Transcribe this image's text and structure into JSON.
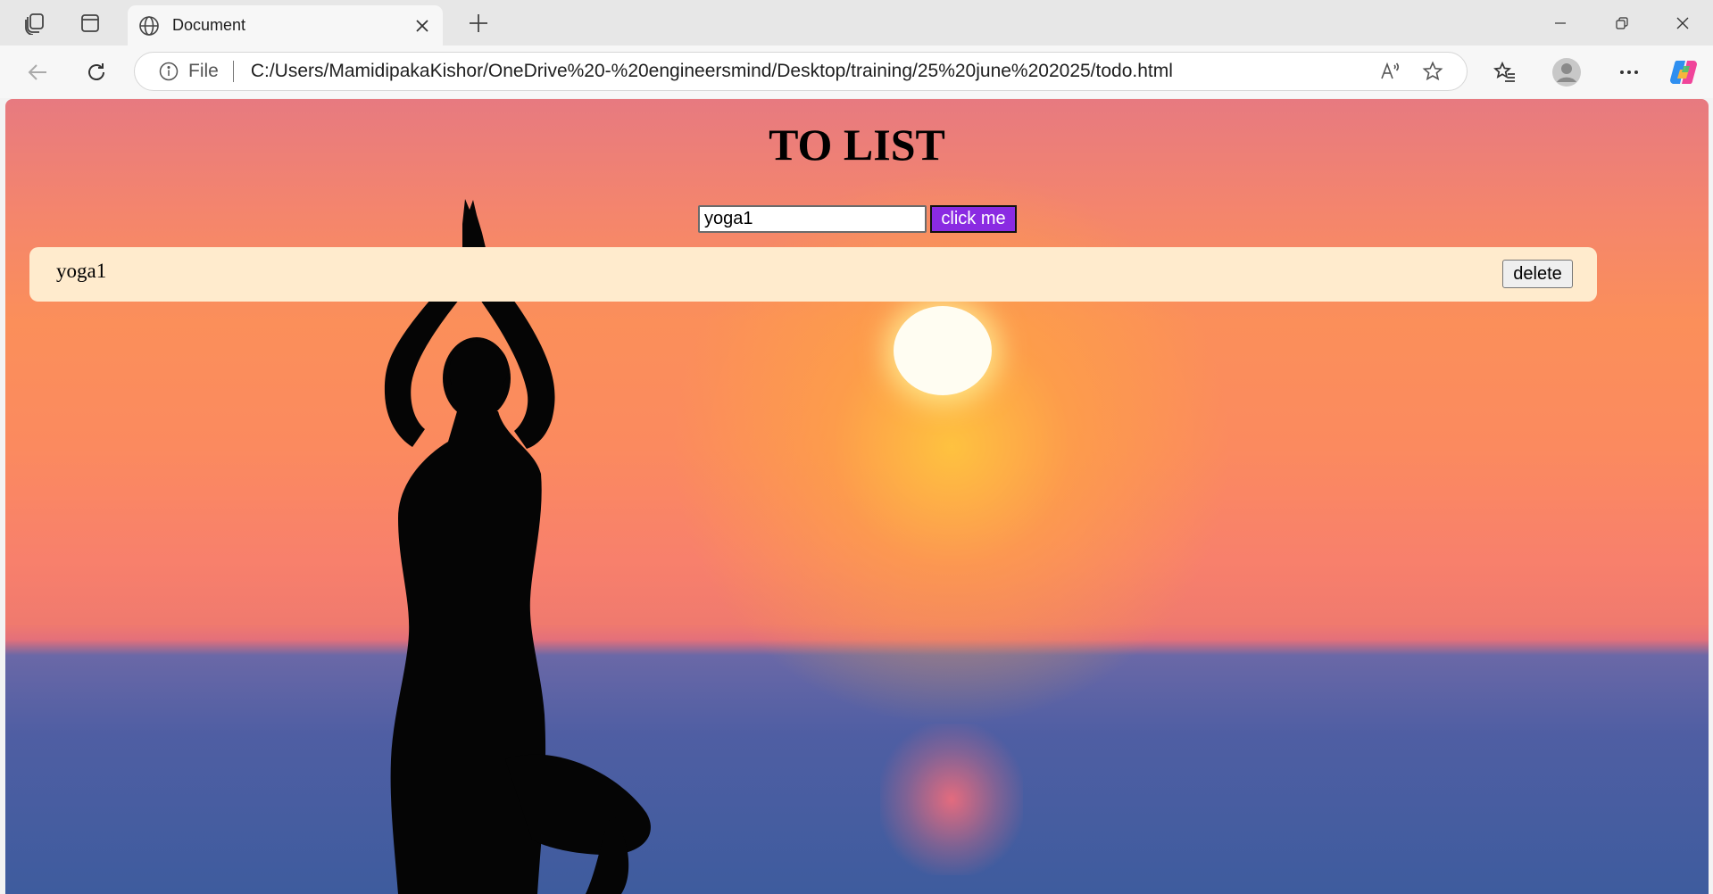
{
  "browser": {
    "tab_title": "Document",
    "url_scheme_label": "File",
    "url": "C:/Users/MamidipakaKishor/OneDrive%20-%20engineersmind/Desktop/training/25%20june%202025/todo.html"
  },
  "page": {
    "heading": "TO LIST",
    "input_value": "yoga1",
    "add_button_label": "click me",
    "todos": [
      {
        "text": "yoga1",
        "delete_label": "delete"
      }
    ]
  },
  "colors": {
    "add_button": "#8a2be2",
    "todo_item_bg": "#ffebcd"
  }
}
